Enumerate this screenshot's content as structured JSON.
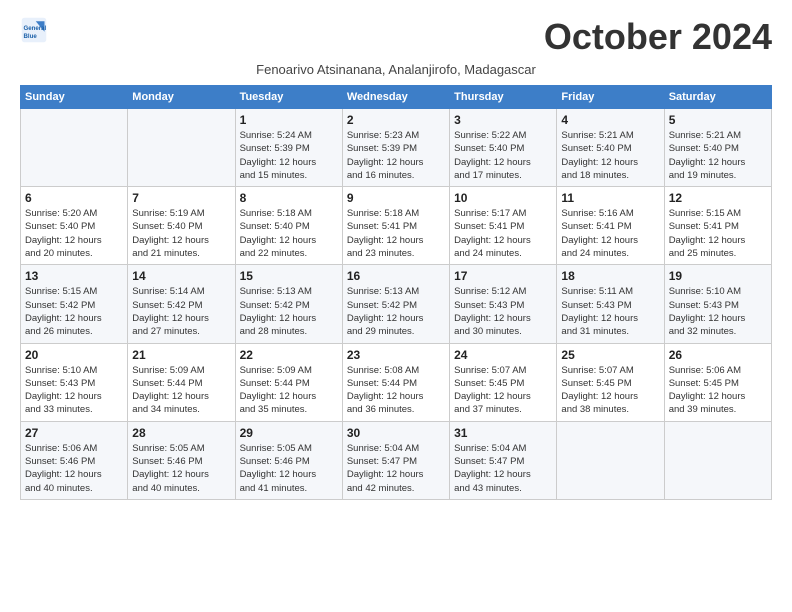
{
  "header": {
    "logo_line1": "General",
    "logo_line2": "Blue",
    "month_title": "October 2024",
    "subtitle": "Fenoarivo Atsinanana, Analanjirofo, Madagascar"
  },
  "days_of_week": [
    "Sunday",
    "Monday",
    "Tuesday",
    "Wednesday",
    "Thursday",
    "Friday",
    "Saturday"
  ],
  "weeks": [
    [
      {
        "day": "",
        "info": ""
      },
      {
        "day": "",
        "info": ""
      },
      {
        "day": "1",
        "info": "Sunrise: 5:24 AM\nSunset: 5:39 PM\nDaylight: 12 hours\nand 15 minutes."
      },
      {
        "day": "2",
        "info": "Sunrise: 5:23 AM\nSunset: 5:39 PM\nDaylight: 12 hours\nand 16 minutes."
      },
      {
        "day": "3",
        "info": "Sunrise: 5:22 AM\nSunset: 5:40 PM\nDaylight: 12 hours\nand 17 minutes."
      },
      {
        "day": "4",
        "info": "Sunrise: 5:21 AM\nSunset: 5:40 PM\nDaylight: 12 hours\nand 18 minutes."
      },
      {
        "day": "5",
        "info": "Sunrise: 5:21 AM\nSunset: 5:40 PM\nDaylight: 12 hours\nand 19 minutes."
      }
    ],
    [
      {
        "day": "6",
        "info": "Sunrise: 5:20 AM\nSunset: 5:40 PM\nDaylight: 12 hours\nand 20 minutes."
      },
      {
        "day": "7",
        "info": "Sunrise: 5:19 AM\nSunset: 5:40 PM\nDaylight: 12 hours\nand 21 minutes."
      },
      {
        "day": "8",
        "info": "Sunrise: 5:18 AM\nSunset: 5:40 PM\nDaylight: 12 hours\nand 22 minutes."
      },
      {
        "day": "9",
        "info": "Sunrise: 5:18 AM\nSunset: 5:41 PM\nDaylight: 12 hours\nand 23 minutes."
      },
      {
        "day": "10",
        "info": "Sunrise: 5:17 AM\nSunset: 5:41 PM\nDaylight: 12 hours\nand 24 minutes."
      },
      {
        "day": "11",
        "info": "Sunrise: 5:16 AM\nSunset: 5:41 PM\nDaylight: 12 hours\nand 24 minutes."
      },
      {
        "day": "12",
        "info": "Sunrise: 5:15 AM\nSunset: 5:41 PM\nDaylight: 12 hours\nand 25 minutes."
      }
    ],
    [
      {
        "day": "13",
        "info": "Sunrise: 5:15 AM\nSunset: 5:42 PM\nDaylight: 12 hours\nand 26 minutes."
      },
      {
        "day": "14",
        "info": "Sunrise: 5:14 AM\nSunset: 5:42 PM\nDaylight: 12 hours\nand 27 minutes."
      },
      {
        "day": "15",
        "info": "Sunrise: 5:13 AM\nSunset: 5:42 PM\nDaylight: 12 hours\nand 28 minutes."
      },
      {
        "day": "16",
        "info": "Sunrise: 5:13 AM\nSunset: 5:42 PM\nDaylight: 12 hours\nand 29 minutes."
      },
      {
        "day": "17",
        "info": "Sunrise: 5:12 AM\nSunset: 5:43 PM\nDaylight: 12 hours\nand 30 minutes."
      },
      {
        "day": "18",
        "info": "Sunrise: 5:11 AM\nSunset: 5:43 PM\nDaylight: 12 hours\nand 31 minutes."
      },
      {
        "day": "19",
        "info": "Sunrise: 5:10 AM\nSunset: 5:43 PM\nDaylight: 12 hours\nand 32 minutes."
      }
    ],
    [
      {
        "day": "20",
        "info": "Sunrise: 5:10 AM\nSunset: 5:43 PM\nDaylight: 12 hours\nand 33 minutes."
      },
      {
        "day": "21",
        "info": "Sunrise: 5:09 AM\nSunset: 5:44 PM\nDaylight: 12 hours\nand 34 minutes."
      },
      {
        "day": "22",
        "info": "Sunrise: 5:09 AM\nSunset: 5:44 PM\nDaylight: 12 hours\nand 35 minutes."
      },
      {
        "day": "23",
        "info": "Sunrise: 5:08 AM\nSunset: 5:44 PM\nDaylight: 12 hours\nand 36 minutes."
      },
      {
        "day": "24",
        "info": "Sunrise: 5:07 AM\nSunset: 5:45 PM\nDaylight: 12 hours\nand 37 minutes."
      },
      {
        "day": "25",
        "info": "Sunrise: 5:07 AM\nSunset: 5:45 PM\nDaylight: 12 hours\nand 38 minutes."
      },
      {
        "day": "26",
        "info": "Sunrise: 5:06 AM\nSunset: 5:45 PM\nDaylight: 12 hours\nand 39 minutes."
      }
    ],
    [
      {
        "day": "27",
        "info": "Sunrise: 5:06 AM\nSunset: 5:46 PM\nDaylight: 12 hours\nand 40 minutes."
      },
      {
        "day": "28",
        "info": "Sunrise: 5:05 AM\nSunset: 5:46 PM\nDaylight: 12 hours\nand 40 minutes."
      },
      {
        "day": "29",
        "info": "Sunrise: 5:05 AM\nSunset: 5:46 PM\nDaylight: 12 hours\nand 41 minutes."
      },
      {
        "day": "30",
        "info": "Sunrise: 5:04 AM\nSunset: 5:47 PM\nDaylight: 12 hours\nand 42 minutes."
      },
      {
        "day": "31",
        "info": "Sunrise: 5:04 AM\nSunset: 5:47 PM\nDaylight: 12 hours\nand 43 minutes."
      },
      {
        "day": "",
        "info": ""
      },
      {
        "day": "",
        "info": ""
      }
    ]
  ]
}
